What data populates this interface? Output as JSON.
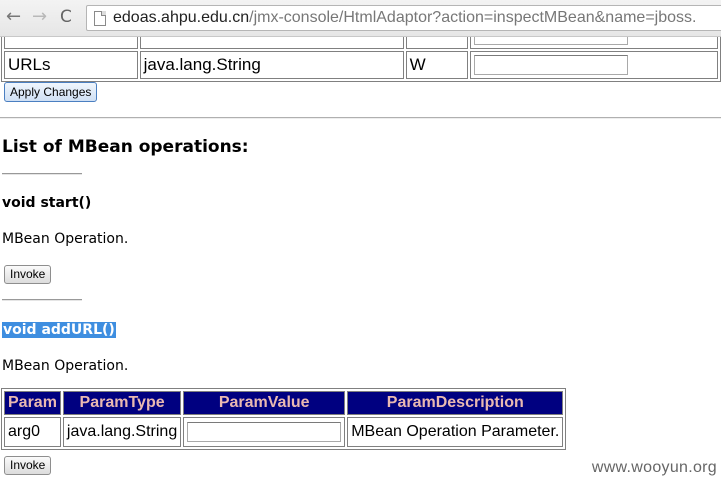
{
  "browser": {
    "back_icon": "←",
    "forward_icon": "→",
    "reload_icon": "C",
    "url_host": "edoas.ahpu.edu.cn",
    "url_path": "/jmx-console/HtmlAdaptor?action=inspectMBean&name=jboss."
  },
  "attributes": {
    "rows": [
      {
        "name": "URLs",
        "type": "java.lang.String",
        "access": "W",
        "value": ""
      }
    ],
    "apply_label": "Apply Changes"
  },
  "operations": {
    "heading": "List of MBean operations:",
    "items": [
      {
        "signature": "void start()",
        "description": "MBean Operation.",
        "invoke_label": "Invoke"
      },
      {
        "signature": "void addURL()",
        "description": "MBean Operation.",
        "invoke_label": "Invoke",
        "params": {
          "headers": [
            "Param",
            "ParamType",
            "ParamValue",
            "ParamDescription"
          ],
          "rows": [
            {
              "param": "arg0",
              "type": "java.lang.String",
              "value": "",
              "description": "MBean Operation Parameter."
            }
          ]
        }
      }
    ]
  },
  "watermark": "www.wooyun.org",
  "colors": {
    "table_header_bg": "#000080",
    "table_header_text": "#e9b9b1",
    "selection_highlight": "#3e8ee0"
  }
}
